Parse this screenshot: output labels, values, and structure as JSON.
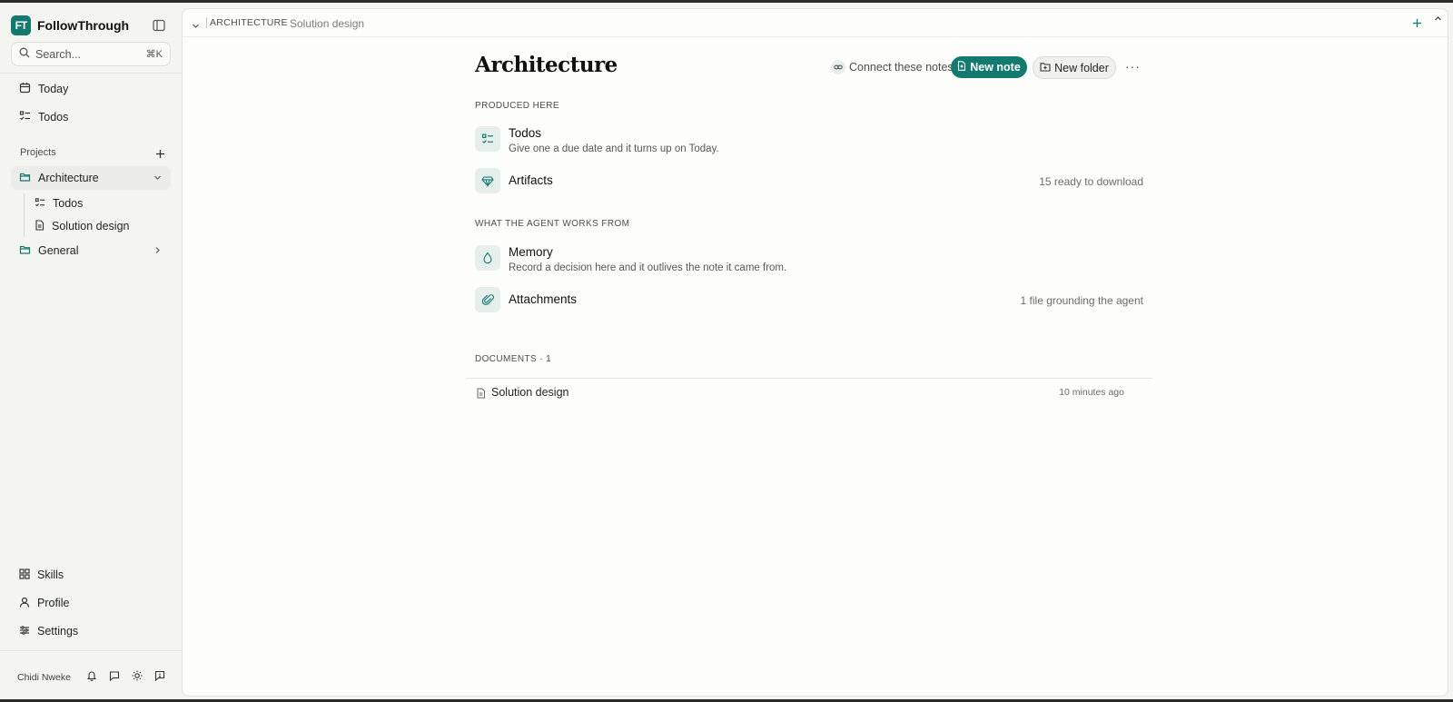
{
  "app": {
    "name": "FollowThrough",
    "logo_text": "FT",
    "accent": "#127a6e"
  },
  "search": {
    "placeholder": "Search...",
    "shortcut": "⌘K"
  },
  "nav": {
    "today": "Today",
    "todos": "Todos"
  },
  "projects": {
    "label": "Projects",
    "items": [
      {
        "label": "Architecture",
        "children": [
          {
            "label": "Todos"
          },
          {
            "label": "Solution design"
          }
        ]
      },
      {
        "label": "General"
      }
    ]
  },
  "bottom_nav": {
    "skills": "Skills",
    "profile": "Profile",
    "settings": "Settings"
  },
  "user": {
    "name": "Chidi Nweke"
  },
  "topbar": {
    "crumb": "ARCHITECTURE",
    "title": "Solution design"
  },
  "page": {
    "title": "Architecture",
    "connect_label": "Connect these notes",
    "new_note_label": "New note",
    "new_folder_label": "New folder",
    "more_label": "···"
  },
  "produced": {
    "heading": "PRODUCED HERE",
    "todos": {
      "title": "Todos",
      "subtitle": "Give one a due date and it turns up on Today."
    },
    "artifacts": {
      "title": "Artifacts",
      "meta": "15 ready to download"
    }
  },
  "works_from": {
    "heading": "WHAT THE AGENT WORKS FROM",
    "memory": {
      "title": "Memory",
      "subtitle": "Record a decision here and it outlives the note it came from."
    },
    "attachments": {
      "title": "Attachments",
      "meta": "1 file grounding the agent"
    }
  },
  "documents": {
    "heading": "DOCUMENTS · 1",
    "items": [
      {
        "name": "Solution design",
        "time": "10 minutes ago"
      }
    ]
  }
}
